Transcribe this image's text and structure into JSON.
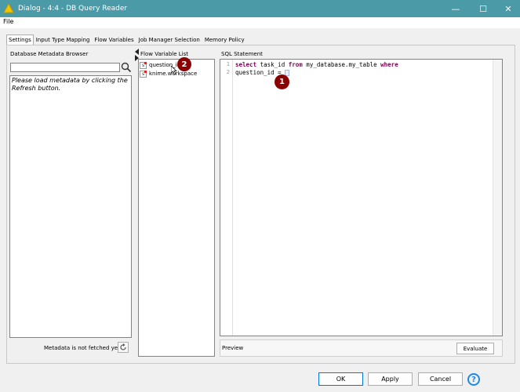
{
  "window": {
    "title": "Dialog - 4:4 - DB Query Reader",
    "minimize_glyph": "—",
    "maximize_glyph": "☐",
    "close_glyph": "✕"
  },
  "menu": {
    "file": "File"
  },
  "tabs": [
    "Settings",
    "Input Type Mapping",
    "Flow Variables",
    "Job Manager Selection",
    "Memory Policy"
  ],
  "metadata_browser": {
    "label": "Database Metadata Browser",
    "message": "Please load metadata by clicking the Refresh button.",
    "status": "Metadata is not fetched yet."
  },
  "flow_variables": {
    "label": "Flow Variable List",
    "items": [
      {
        "icon_text": "s",
        "name": "question_id"
      },
      {
        "icon_text": "s",
        "name": "knime.workspace"
      }
    ]
  },
  "sql": {
    "label": "SQL Statement",
    "line_numbers": [
      "1",
      "2"
    ],
    "line1": {
      "kw1": "select",
      "t1": " task_id ",
      "kw2": "from",
      "t2": " my_database.my_table ",
      "kw3": "where"
    },
    "line2": "question_id = "
  },
  "preview": {
    "label": "Preview",
    "evaluate": "Evaluate"
  },
  "buttons": {
    "ok": "OK",
    "apply": "Apply",
    "cancel": "Cancel",
    "help": "?"
  },
  "markers": [
    "1",
    "2"
  ],
  "colors": {
    "titlebar": "#4a9aa8",
    "keyword": "#7f0055",
    "marker": "#8b0000",
    "help": "#1e88e5"
  },
  "icons": [
    "knime-logo-icon",
    "search-icon",
    "refresh-icon",
    "string-variable-icon",
    "help-icon"
  ]
}
